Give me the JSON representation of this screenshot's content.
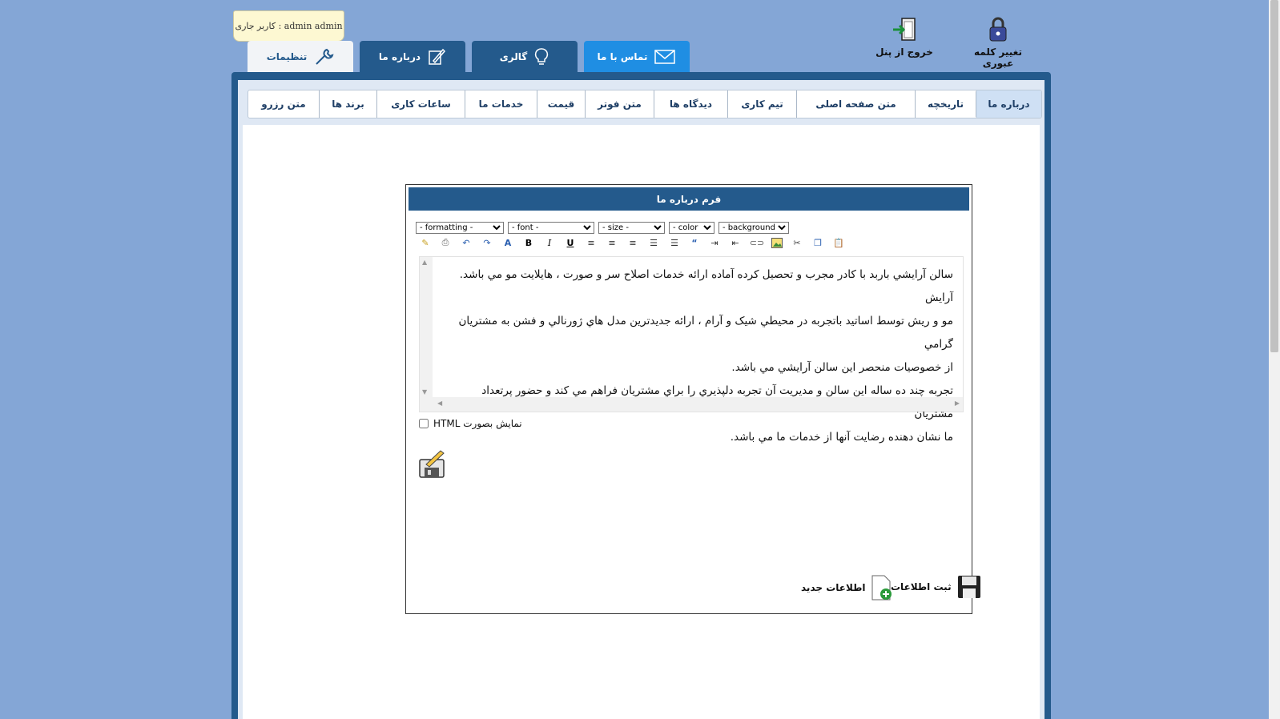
{
  "header": {
    "change_password_label": "تغيير كلمه عبوری",
    "logout_label": "خروج از پنل",
    "current_user_label": "admin admin : كاربر جاری"
  },
  "main_tabs": [
    {
      "label": "تماس با ما",
      "icon": "envelope-icon"
    },
    {
      "label": "گالری",
      "icon": "lightbulb-icon"
    },
    {
      "label": "درباره ما",
      "icon": "edit-icon"
    },
    {
      "label": "تنظيمات",
      "icon": "wrench-icon"
    }
  ],
  "sub_tabs": [
    "درباره ما",
    "تاريخچه",
    "متن صفحه اصلی",
    "تيم كاری",
    "ديدگاه ها",
    "متن فوتر",
    "قيمت",
    "خدمات ما",
    "ساعات كاری",
    "برند ها",
    "متن رزرو"
  ],
  "form": {
    "title": "فرم درباره ما",
    "toolbar_selects": {
      "formatting": "- formatting -",
      "font": "- font -",
      "size": "- size -",
      "color": "- color -",
      "background": "- background -"
    },
    "editor_lines": [
      "سالن آرايشي باربد با كادر مجرب و تحصيل كرده آماده ارائه خدمات اصلاح سر و صورت ، هايلايت مو مي باشد. آرايش",
      "مو و ريش توسط اساتيد باتجربه در محيطي شيک و آرام ، ارائه جديدترين مدل هاي ژورنالي و فشن به مشتريان گرامي",
      "از خصوصيات منحصر اين سالن آرايشي مي باشد.",
      "تجربه چند ده ساله اين سالن و مديريت آن تجربه دلپذيري را براي مشتريان فراهم مي كند و حضور پرتعداد مشتريان",
      "ما نشان دهنده رضايت آنها از خدمات ما مي باشد."
    ],
    "html_mode_label": "نمايش بصورت HTML",
    "save_label": "ثبت اطلاعات",
    "new_label": "اطلاعات جديد"
  },
  "colors": {
    "page_bg": "#84a6d6",
    "brand_dark": "#245a8c",
    "active_tab": "#1f8ee3"
  }
}
